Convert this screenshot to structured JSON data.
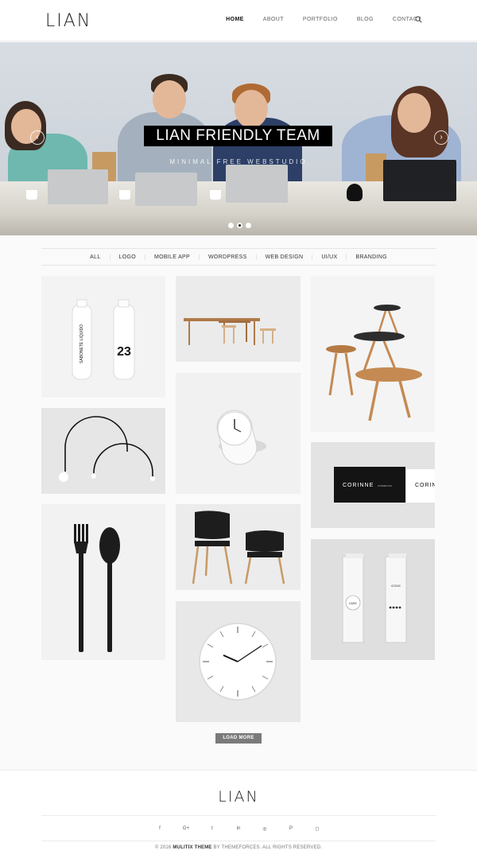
{
  "header": {
    "logo": "LIAN",
    "nav": [
      "HOME",
      "ABOUT",
      "PORTFOLIO",
      "BLOG",
      "CONTACT"
    ],
    "active_nav": "HOME",
    "search_icon": "search-icon"
  },
  "hero": {
    "title": "LIAN FRIENDLY TEAM",
    "subtitle": "MINIMAL FREE WEBSTUDIO",
    "slides": 3,
    "active_slide": 2
  },
  "filters": [
    "ALL",
    "LOGO",
    "MOBILE APP",
    "WORDPRESS",
    "WEB DESIGN",
    "UI/UX",
    "BRANDING"
  ],
  "portfolio": {
    "bottle_number": "23",
    "bottle_label": "SABONETE LIQUIDO",
    "card_brand": "CORINNE",
    "card_sub": "COSMETICS",
    "box_brand": "ICONIC",
    "box_logo": "DARK"
  },
  "load_more": "LOAD MORE",
  "footer": {
    "logo": "LIAN",
    "socials": [
      "f",
      "G+",
      "t",
      "in",
      "◎",
      "P",
      "◻"
    ],
    "copyright_prefix": "© 2016",
    "copyright_theme": "MULITIX THEME",
    "copyright_suffix": "BY THEMEFORCES. ALL RIGHTS RESERVED."
  },
  "colors": {
    "accent": "#000000",
    "button": "#7a7a7a",
    "background": "#fafafa"
  }
}
